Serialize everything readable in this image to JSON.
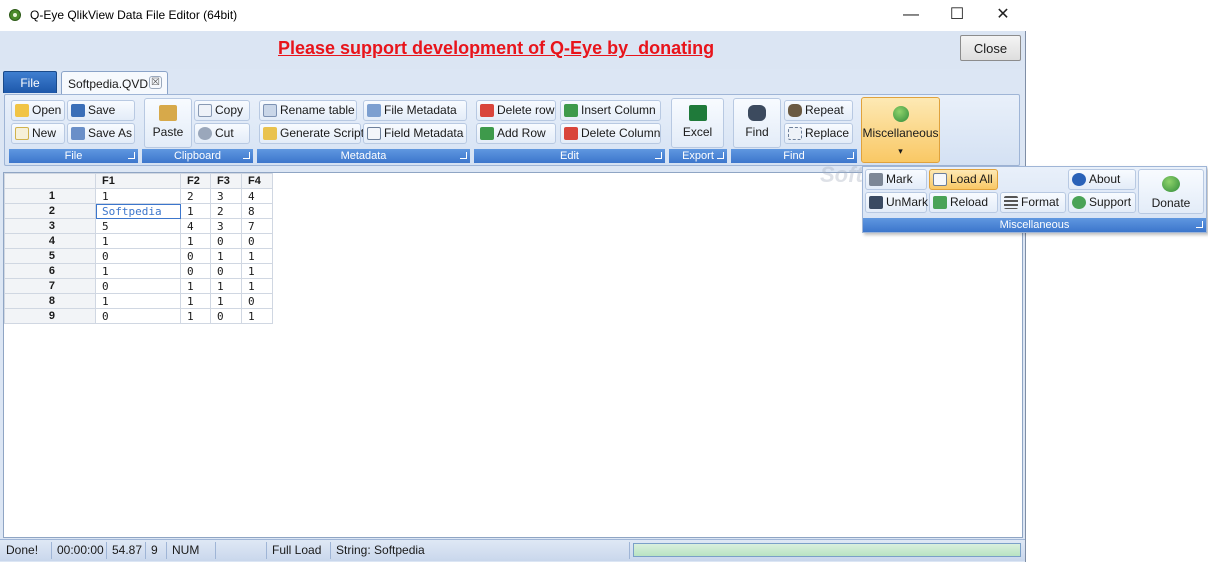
{
  "window": {
    "title": "Q-Eye QlikView Data File Editor (64bit)",
    "minimize": "—",
    "maximize": "☐",
    "close": "✕"
  },
  "banner": {
    "text": "Please support development of Q-Eye by  donating",
    "close_label": "Close",
    "color": "#e8141b"
  },
  "tabs": {
    "file": "File",
    "document": "Softpedia.QVD",
    "document_close": "☒"
  },
  "ribbon": {
    "file": {
      "label": "File",
      "open": "Open",
      "save": "Save",
      "new": "New",
      "save_as": "Save As"
    },
    "clipboard": {
      "label": "Clipboard",
      "paste": "Paste",
      "copy": "Copy",
      "cut": "Cut"
    },
    "metadata": {
      "label": "Metadata",
      "rename_table": "Rename table",
      "file_metadata": "File Metadata",
      "generate_script": "Generate Script",
      "field_metadata": "Field Metadata"
    },
    "edit": {
      "label": "Edit",
      "delete_row": "Delete row",
      "insert_column": "Insert Column",
      "add_row": "Add Row",
      "delete_column": "Delete Column"
    },
    "export": {
      "label": "Export",
      "excel": "Excel"
    },
    "find": {
      "label": "Find",
      "find": "Find",
      "repeat": "Repeat",
      "replace": "Replace"
    },
    "misc": {
      "label": "Miscellaneous",
      "arrow": "▾"
    }
  },
  "popup": {
    "label": "Miscellaneous",
    "mark": "Mark",
    "load_all": "Load All",
    "about": "About",
    "donate": "Donate",
    "unmark": "UnMark",
    "reload": "Reload",
    "format": "Format",
    "support": "Support"
  },
  "grid": {
    "columns": [
      "F1",
      "F2",
      "F3",
      "F4"
    ],
    "rows": [
      [
        "1",
        "1",
        "2",
        "3",
        "4"
      ],
      [
        "2",
        "Softpedia",
        "1",
        "2",
        "8"
      ],
      [
        "3",
        "5",
        "4",
        "3",
        "7"
      ],
      [
        "4",
        "1",
        "1",
        "0",
        "0"
      ],
      [
        "5",
        "0",
        "0",
        "1",
        "1"
      ],
      [
        "6",
        "1",
        "0",
        "0",
        "1"
      ],
      [
        "7",
        "0",
        "1",
        "1",
        "1"
      ],
      [
        "8",
        "1",
        "1",
        "1",
        "0"
      ],
      [
        "9",
        "0",
        "1",
        "0",
        "1"
      ]
    ]
  },
  "status": {
    "state": "Done!",
    "time": "00:00:00",
    "value": "54.87",
    "rows": "9",
    "num": "NUM",
    "load": "Full Load",
    "string": "String: Softpedia",
    "progress": 1.0
  },
  "watermark": "Softpedia",
  "colors": {
    "accent": "#3c76cc",
    "ribbon_bg": "#dce6f4",
    "selected": "#f9c865"
  }
}
